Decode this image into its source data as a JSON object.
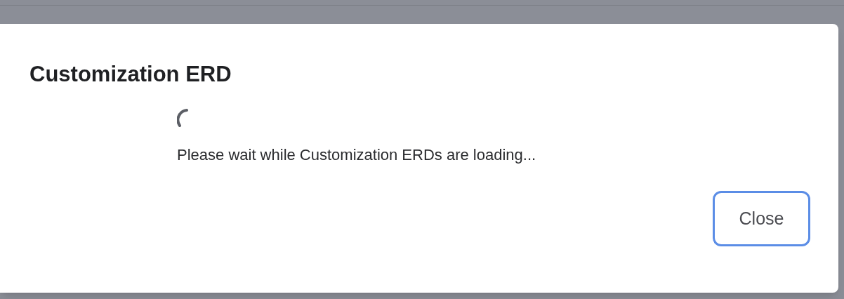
{
  "dialog": {
    "title": "Customization ERD",
    "loading": {
      "message": "Please wait while Customization ERDs are loading..."
    },
    "buttons": [
      {
        "label": "Close",
        "focused": true
      }
    ]
  }
}
